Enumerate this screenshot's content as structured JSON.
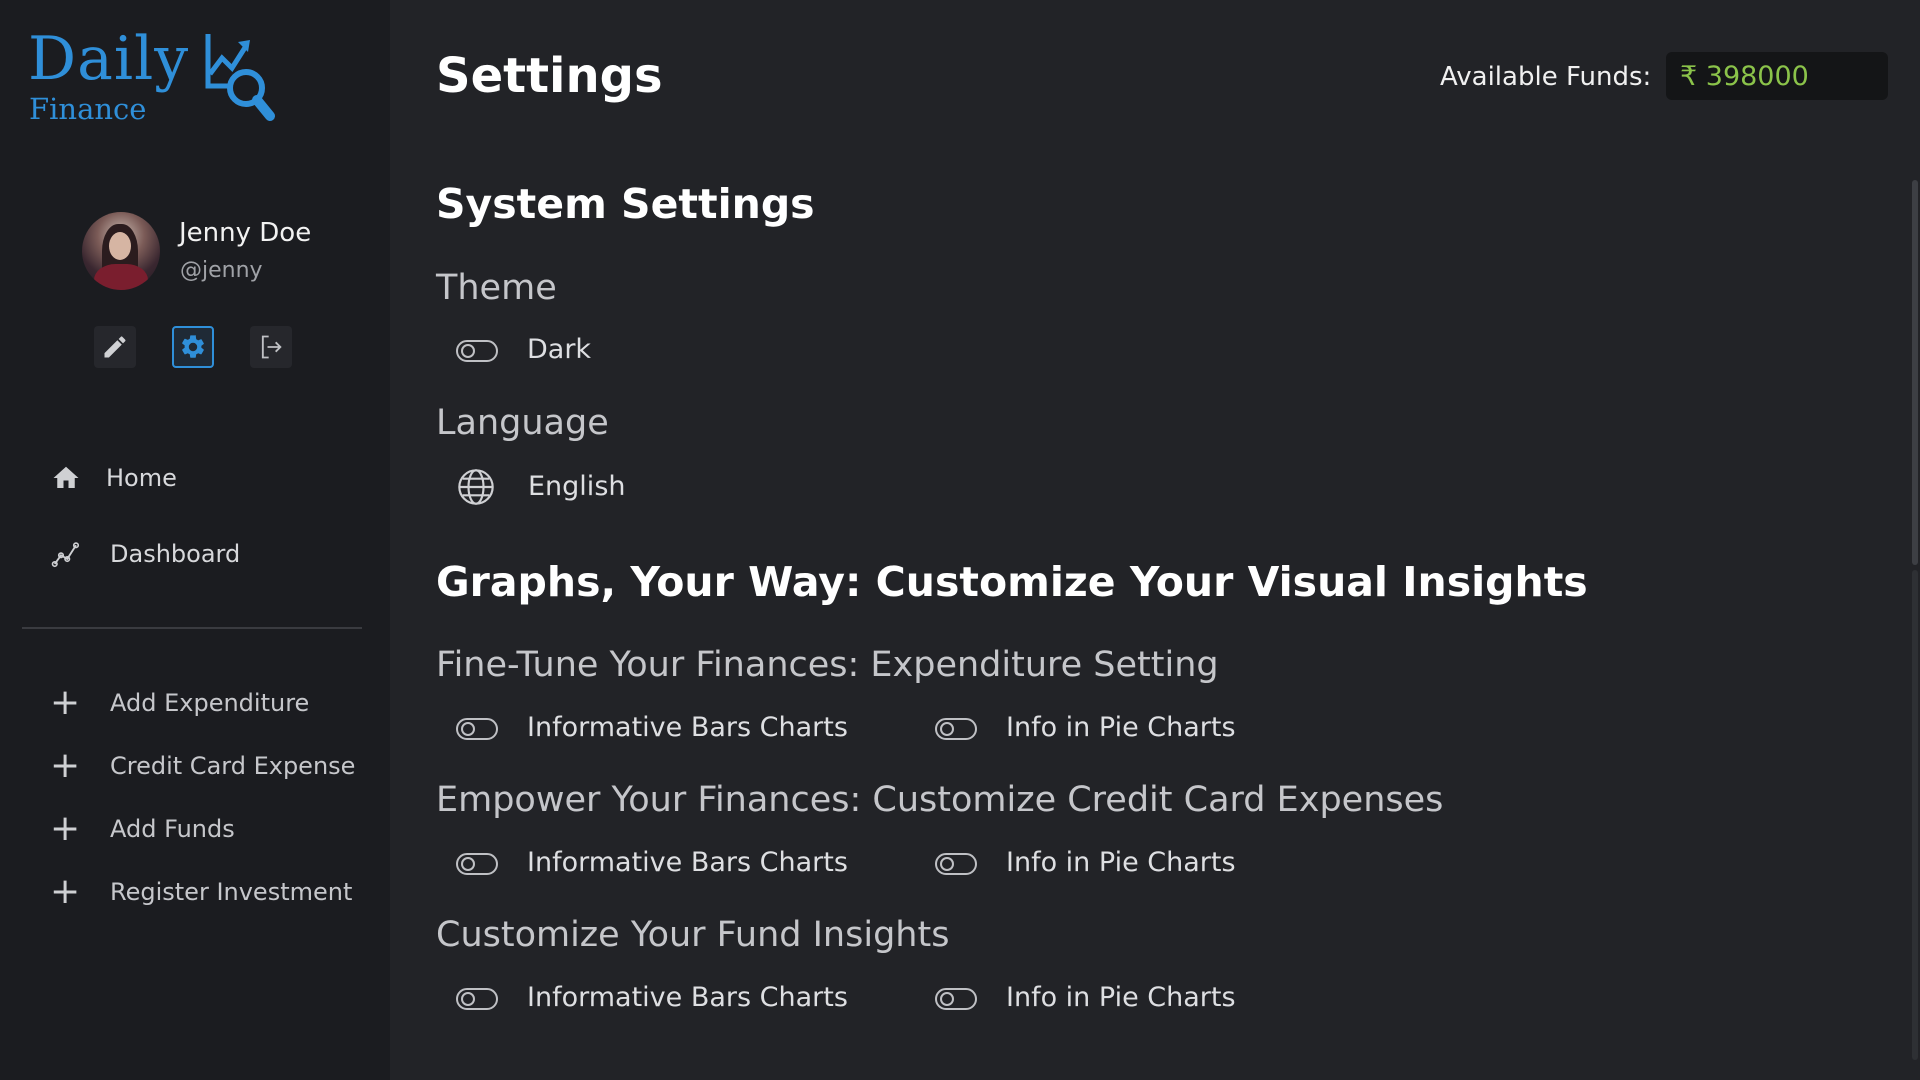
{
  "brand": {
    "name_top": "Daily",
    "name_bottom": "Finance"
  },
  "user": {
    "name": "Jenny Doe",
    "handle": "@jenny"
  },
  "quick_actions": [
    {
      "icon": "pencil-icon"
    },
    {
      "icon": "gear-icon",
      "active": true
    },
    {
      "icon": "logout-icon"
    }
  ],
  "nav": [
    {
      "label": "Home",
      "icon": "home-icon"
    },
    {
      "label": "Dashboard",
      "icon": "chart-line-icon"
    }
  ],
  "actions": [
    {
      "label": "Add Expenditure"
    },
    {
      "label": "Credit Card Expense"
    },
    {
      "label": "Add Funds"
    },
    {
      "label": "Register Investment"
    }
  ],
  "header": {
    "title": "Settings",
    "funds_label": "Available Funds:",
    "funds_value": "₹ 398000",
    "funds_color": "#8bc34a"
  },
  "system": {
    "heading": "System Settings",
    "theme_heading": "Theme",
    "theme_option": "Dark",
    "theme_on": false,
    "language_heading": "Language",
    "language_value": "English"
  },
  "graphs": {
    "heading": "Graphs, Your Way: Customize Your Visual Insights",
    "sections": [
      {
        "title": "Fine-Tune Your Finances: Expenditure Setting",
        "bars_label": "Informative Bars Charts",
        "pie_label": "Info in Pie Charts",
        "bars_on": false,
        "pie_on": false
      },
      {
        "title": "Empower Your Finances: Customize Credit Card Expenses",
        "bars_label": "Informative Bars Charts",
        "pie_label": "Info in Pie Charts",
        "bars_on": false,
        "pie_on": false
      },
      {
        "title": "Customize Your Fund Insights",
        "bars_label": "Informative Bars Charts",
        "pie_label": "Info in Pie Charts",
        "bars_on": false,
        "pie_on": false
      }
    ]
  },
  "colors": {
    "accent": "#2f8fd9",
    "background": "#222327",
    "sidebar": "#1b1c20"
  }
}
